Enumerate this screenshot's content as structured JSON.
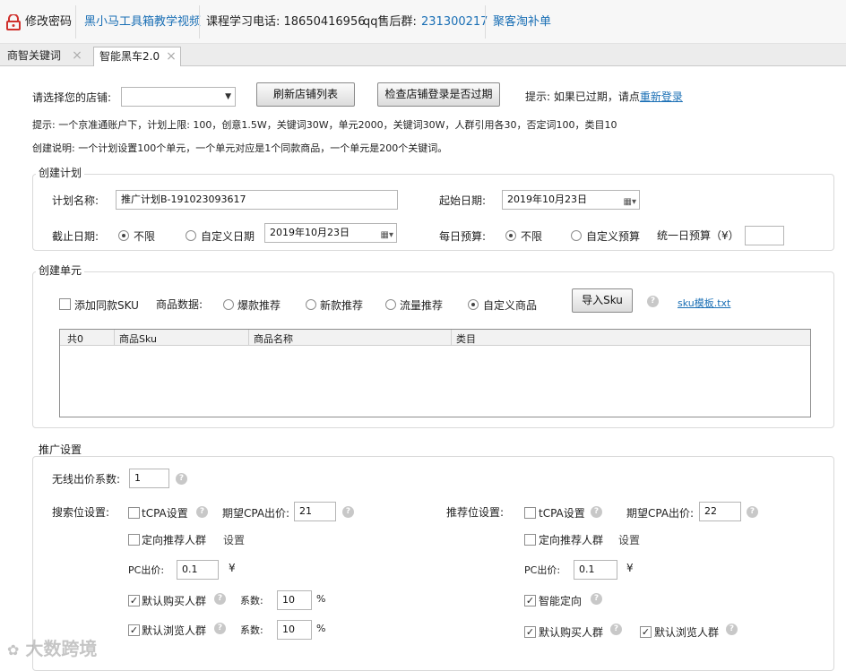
{
  "topbar": {
    "change_password": "修改密码",
    "tutorial_link": "黑小马工具箱教学视频",
    "phone": "课程学习电话: 18650416956",
    "qq_label": "qq售后群:",
    "qq_number": "231300217",
    "juke_link": "聚客淘补单"
  },
  "tabs": [
    {
      "label": "商智关键词"
    },
    {
      "label": "智能黑车2.0"
    }
  ],
  "store": {
    "label": "请选择您的店铺:",
    "selected": "",
    "refresh_button": "刷新店铺列表",
    "check_button": "检查店铺登录是否过期",
    "hint_prefix": "提示: 如果已过期，请点",
    "relogin_link": "重新登录"
  },
  "notes": {
    "limits": "提示: 一个京准通账户下，计划上限: 100，创意1.5W，关键词30W，单元2000，关键词30W，人群引用各30，否定词100，类目10",
    "creation": "创建说明: 一个计划设置100个单元，一个单元对应是1个同款商品，一个单元是200个关键词。"
  },
  "plan": {
    "title": "创建计划",
    "name_label": "计划名称:",
    "name_value": "推广计划B-191023093617",
    "start_label": "起始日期:",
    "start_value": "2019年10月23日",
    "end_label": "截止日期:",
    "end_unlimited": "不限",
    "end_custom": "自定义日期",
    "end_value": "2019年10月23日",
    "budget_label": "每日预算:",
    "budget_unlimited": "不限",
    "budget_custom": "自定义预算",
    "unified_budget_label": "统一日预算（¥）",
    "unified_budget_value": ""
  },
  "unit": {
    "title": "创建单元",
    "add_same_sku": "添加同款SKU",
    "product_data_label": "商品数据:",
    "options": [
      "爆款推荐",
      "新款推荐",
      "流量推荐",
      "自定义商品"
    ],
    "import_button": "导入Sku",
    "template_link": "sku模板.txt",
    "table_headers": [
      "共0",
      "商品Sku",
      "商品名称",
      "类目"
    ],
    "rows": []
  },
  "promo": {
    "title": "推广设置",
    "wireless_label": "无线出价系数:",
    "wireless_value": "1",
    "search": {
      "label": "搜索位设置:",
      "tcpa": "tCPA设置",
      "cpa_label": "期望CPA出价:",
      "cpa_value": "21",
      "targeted": "定向推荐人群",
      "settings_link": "设置",
      "pc_label": "PC出价:",
      "pc_value": "0.1",
      "yen": "¥",
      "buyers": "默认购买人群",
      "coef_label": "系数:",
      "buyers_coef": "10",
      "browsers": "默认浏览人群",
      "browsers_coef": "10",
      "percent": "%"
    },
    "recommend": {
      "label": "推荐位设置:",
      "tcpa": "tCPA设置",
      "cpa_label": "期望CPA出价:",
      "cpa_value": "22",
      "targeted": "定向推荐人群",
      "settings_link": "设置",
      "pc_label": "PC出价:",
      "pc_value": "0.1",
      "yen": "¥",
      "smart": "智能定向",
      "buyers": "默认购买人群",
      "browsers": "默认浏览人群"
    }
  },
  "watermark": "大数跨境",
  "help_glyph": "?",
  "check_glyph": "✓",
  "close_glyph": "×"
}
